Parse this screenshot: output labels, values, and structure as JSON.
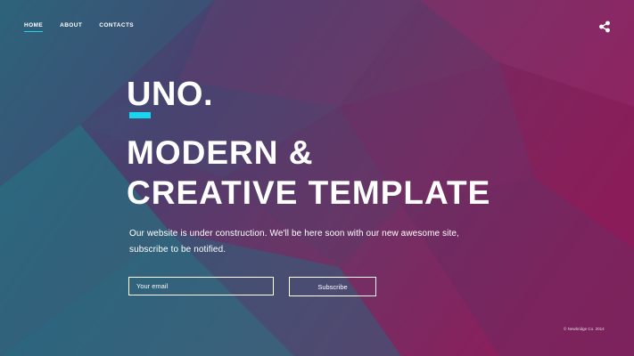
{
  "nav": {
    "items": [
      {
        "label": "HOME",
        "active": true
      },
      {
        "label": "ABOUT",
        "active": false
      },
      {
        "label": "CONTACTS",
        "active": false
      }
    ]
  },
  "header": {
    "share_icon": "share-icon"
  },
  "hero": {
    "logo": "UNO.",
    "headline_line1": "MODERN &",
    "headline_line2": "CREATIVE TEMPLATE",
    "description": "Our website is under construction. We'll be here soon with our new awesome site, subscribe to be notified."
  },
  "subscribe_form": {
    "email_placeholder": "Your email",
    "button_label": "Subscribe"
  },
  "footer": {
    "copyright": "© Newbridge Co. 2014"
  },
  "colors": {
    "accent": "#19d6ef",
    "background_teal": "#2b6f83",
    "background_magenta": "#8a1f5c"
  }
}
